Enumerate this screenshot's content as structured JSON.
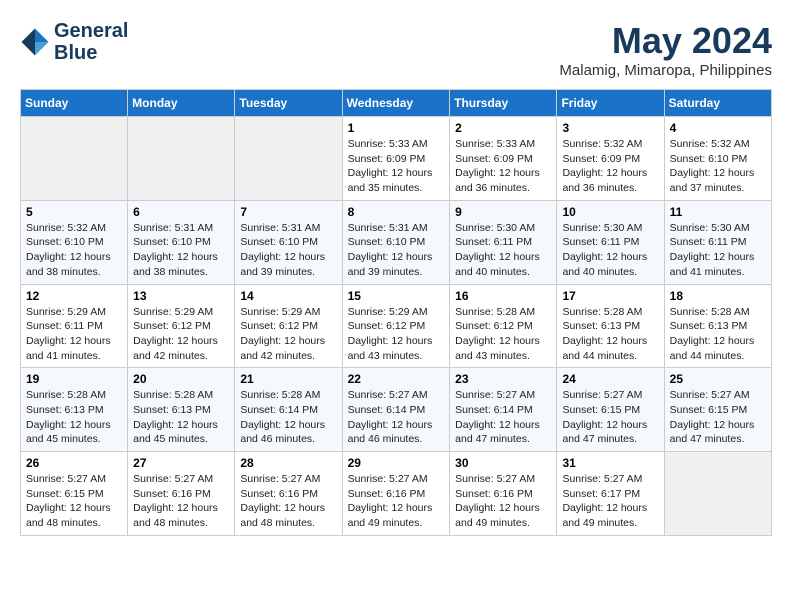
{
  "logo": {
    "line1": "General",
    "line2": "Blue"
  },
  "title": "May 2024",
  "subtitle": "Malamig, Mimaropa, Philippines",
  "days_of_week": [
    "Sunday",
    "Monday",
    "Tuesday",
    "Wednesday",
    "Thursday",
    "Friday",
    "Saturday"
  ],
  "weeks": [
    [
      {
        "day": "",
        "info": ""
      },
      {
        "day": "",
        "info": ""
      },
      {
        "day": "",
        "info": ""
      },
      {
        "day": "1",
        "info": "Sunrise: 5:33 AM\nSunset: 6:09 PM\nDaylight: 12 hours\nand 35 minutes."
      },
      {
        "day": "2",
        "info": "Sunrise: 5:33 AM\nSunset: 6:09 PM\nDaylight: 12 hours\nand 36 minutes."
      },
      {
        "day": "3",
        "info": "Sunrise: 5:32 AM\nSunset: 6:09 PM\nDaylight: 12 hours\nand 36 minutes."
      },
      {
        "day": "4",
        "info": "Sunrise: 5:32 AM\nSunset: 6:10 PM\nDaylight: 12 hours\nand 37 minutes."
      }
    ],
    [
      {
        "day": "5",
        "info": "Sunrise: 5:32 AM\nSunset: 6:10 PM\nDaylight: 12 hours\nand 38 minutes."
      },
      {
        "day": "6",
        "info": "Sunrise: 5:31 AM\nSunset: 6:10 PM\nDaylight: 12 hours\nand 38 minutes."
      },
      {
        "day": "7",
        "info": "Sunrise: 5:31 AM\nSunset: 6:10 PM\nDaylight: 12 hours\nand 39 minutes."
      },
      {
        "day": "8",
        "info": "Sunrise: 5:31 AM\nSunset: 6:10 PM\nDaylight: 12 hours\nand 39 minutes."
      },
      {
        "day": "9",
        "info": "Sunrise: 5:30 AM\nSunset: 6:11 PM\nDaylight: 12 hours\nand 40 minutes."
      },
      {
        "day": "10",
        "info": "Sunrise: 5:30 AM\nSunset: 6:11 PM\nDaylight: 12 hours\nand 40 minutes."
      },
      {
        "day": "11",
        "info": "Sunrise: 5:30 AM\nSunset: 6:11 PM\nDaylight: 12 hours\nand 41 minutes."
      }
    ],
    [
      {
        "day": "12",
        "info": "Sunrise: 5:29 AM\nSunset: 6:11 PM\nDaylight: 12 hours\nand 41 minutes."
      },
      {
        "day": "13",
        "info": "Sunrise: 5:29 AM\nSunset: 6:12 PM\nDaylight: 12 hours\nand 42 minutes."
      },
      {
        "day": "14",
        "info": "Sunrise: 5:29 AM\nSunset: 6:12 PM\nDaylight: 12 hours\nand 42 minutes."
      },
      {
        "day": "15",
        "info": "Sunrise: 5:29 AM\nSunset: 6:12 PM\nDaylight: 12 hours\nand 43 minutes."
      },
      {
        "day": "16",
        "info": "Sunrise: 5:28 AM\nSunset: 6:12 PM\nDaylight: 12 hours\nand 43 minutes."
      },
      {
        "day": "17",
        "info": "Sunrise: 5:28 AM\nSunset: 6:13 PM\nDaylight: 12 hours\nand 44 minutes."
      },
      {
        "day": "18",
        "info": "Sunrise: 5:28 AM\nSunset: 6:13 PM\nDaylight: 12 hours\nand 44 minutes."
      }
    ],
    [
      {
        "day": "19",
        "info": "Sunrise: 5:28 AM\nSunset: 6:13 PM\nDaylight: 12 hours\nand 45 minutes."
      },
      {
        "day": "20",
        "info": "Sunrise: 5:28 AM\nSunset: 6:13 PM\nDaylight: 12 hours\nand 45 minutes."
      },
      {
        "day": "21",
        "info": "Sunrise: 5:28 AM\nSunset: 6:14 PM\nDaylight: 12 hours\nand 46 minutes."
      },
      {
        "day": "22",
        "info": "Sunrise: 5:27 AM\nSunset: 6:14 PM\nDaylight: 12 hours\nand 46 minutes."
      },
      {
        "day": "23",
        "info": "Sunrise: 5:27 AM\nSunset: 6:14 PM\nDaylight: 12 hours\nand 47 minutes."
      },
      {
        "day": "24",
        "info": "Sunrise: 5:27 AM\nSunset: 6:15 PM\nDaylight: 12 hours\nand 47 minutes."
      },
      {
        "day": "25",
        "info": "Sunrise: 5:27 AM\nSunset: 6:15 PM\nDaylight: 12 hours\nand 47 minutes."
      }
    ],
    [
      {
        "day": "26",
        "info": "Sunrise: 5:27 AM\nSunset: 6:15 PM\nDaylight: 12 hours\nand 48 minutes."
      },
      {
        "day": "27",
        "info": "Sunrise: 5:27 AM\nSunset: 6:16 PM\nDaylight: 12 hours\nand 48 minutes."
      },
      {
        "day": "28",
        "info": "Sunrise: 5:27 AM\nSunset: 6:16 PM\nDaylight: 12 hours\nand 48 minutes."
      },
      {
        "day": "29",
        "info": "Sunrise: 5:27 AM\nSunset: 6:16 PM\nDaylight: 12 hours\nand 49 minutes."
      },
      {
        "day": "30",
        "info": "Sunrise: 5:27 AM\nSunset: 6:16 PM\nDaylight: 12 hours\nand 49 minutes."
      },
      {
        "day": "31",
        "info": "Sunrise: 5:27 AM\nSunset: 6:17 PM\nDaylight: 12 hours\nand 49 minutes."
      },
      {
        "day": "",
        "info": ""
      }
    ]
  ]
}
